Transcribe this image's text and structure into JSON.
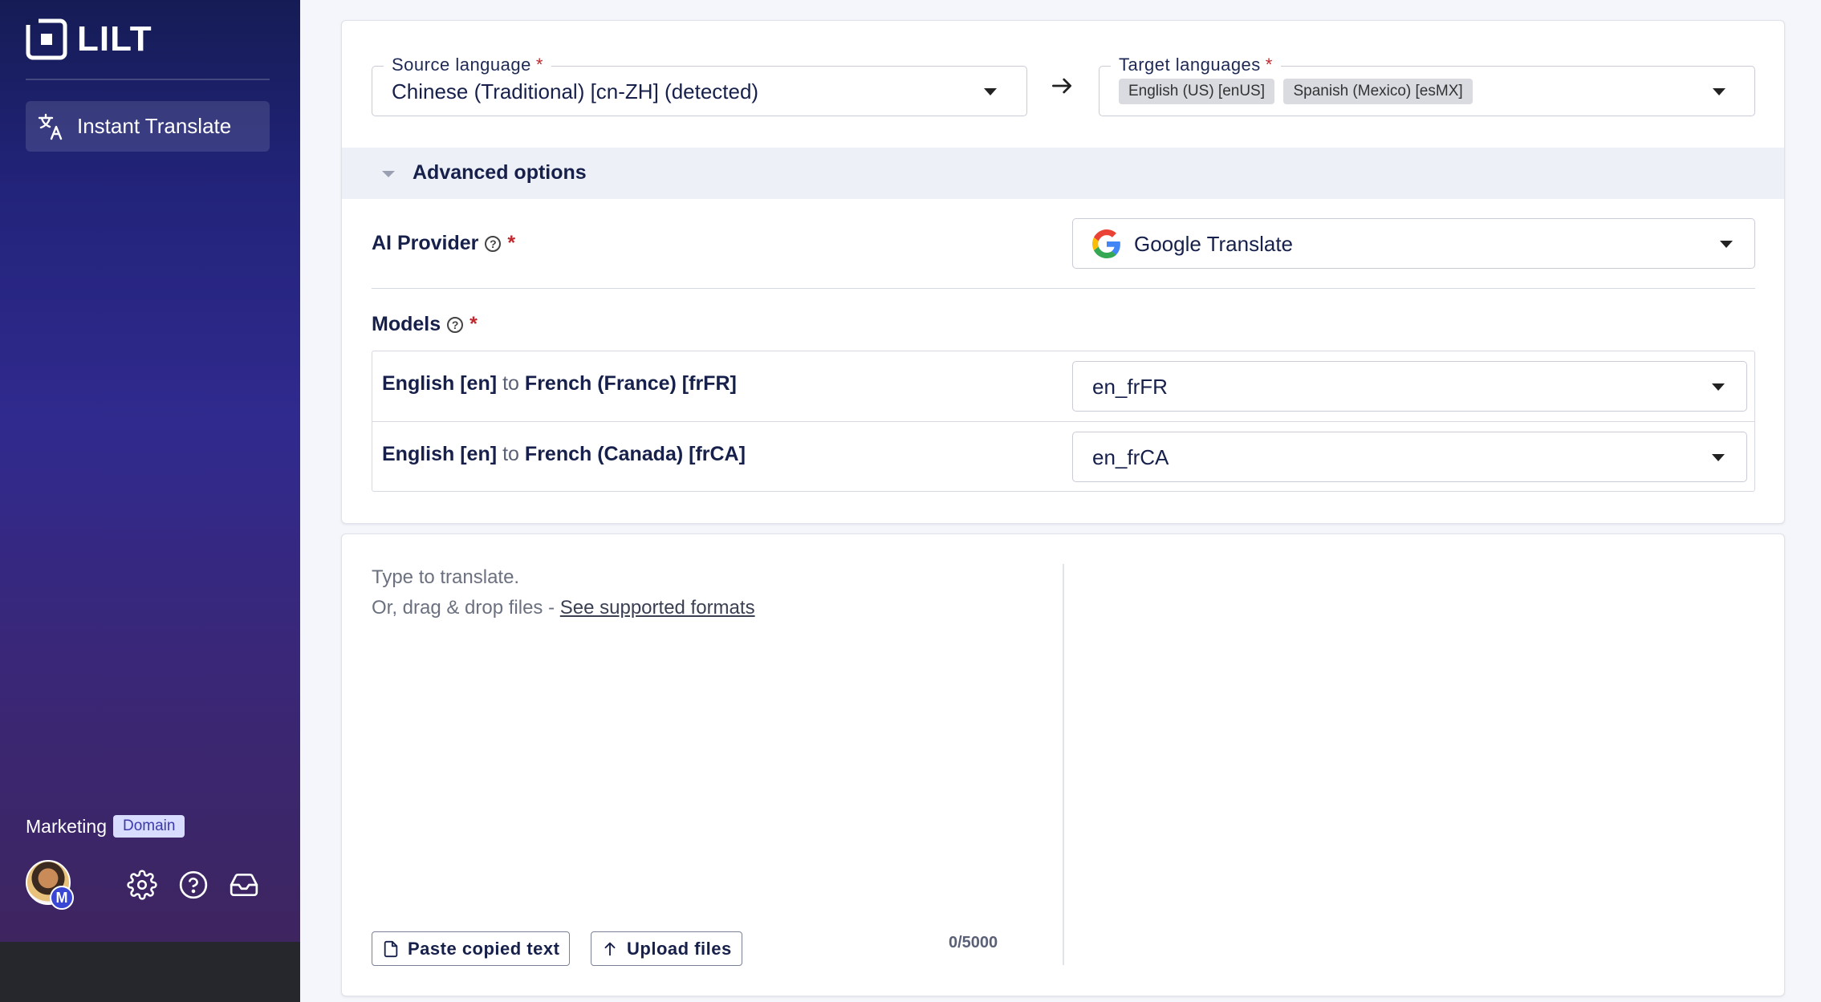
{
  "app": {
    "logo_text": "LILT"
  },
  "sidebar": {
    "nav_items": [
      {
        "label": "Instant Translate",
        "icon": "translate-icon"
      }
    ],
    "workspace": {
      "name": "Marketing",
      "badge": "Domain"
    },
    "user": {
      "avatar_badge": "M"
    },
    "bottom_icons": [
      "gear-icon",
      "help-icon",
      "inbox-icon"
    ]
  },
  "language_bar": {
    "source": {
      "legend": "Source language",
      "required": "*",
      "value": "Chinese (Traditional) [cn-ZH] (detected)"
    },
    "target": {
      "legend": "Target languages",
      "required": "*",
      "chips": [
        "English (US) [enUS]",
        "Spanish (Mexico) [esMX]"
      ]
    }
  },
  "advanced": {
    "label": "Advanced options",
    "ai_provider": {
      "label": "AI Provider",
      "required": "*",
      "value": "Google Translate"
    },
    "models": {
      "label": "Models",
      "required": "*",
      "rows": [
        {
          "source": "English [en]",
          "to": "to",
          "target": "French (France) [frFR]",
          "value": "en_frFR"
        },
        {
          "source": "English [en]",
          "to": "to",
          "target": "French (Canada) [frCA]",
          "value": "en_frCA"
        }
      ]
    }
  },
  "editor": {
    "placeholder_line1": "Type to translate.",
    "placeholder_line2_prefix": "Or, drag & drop files - ",
    "placeholder_link": "See supported formats",
    "paste_button": "Paste copied text",
    "upload_button": "Upload files",
    "char_count": "0/5000"
  },
  "colors": {
    "accent": "#3a47d4",
    "required": "#c0282e",
    "sidebar_top": "#151c55",
    "sidebar_bottom": "#3e2560"
  }
}
